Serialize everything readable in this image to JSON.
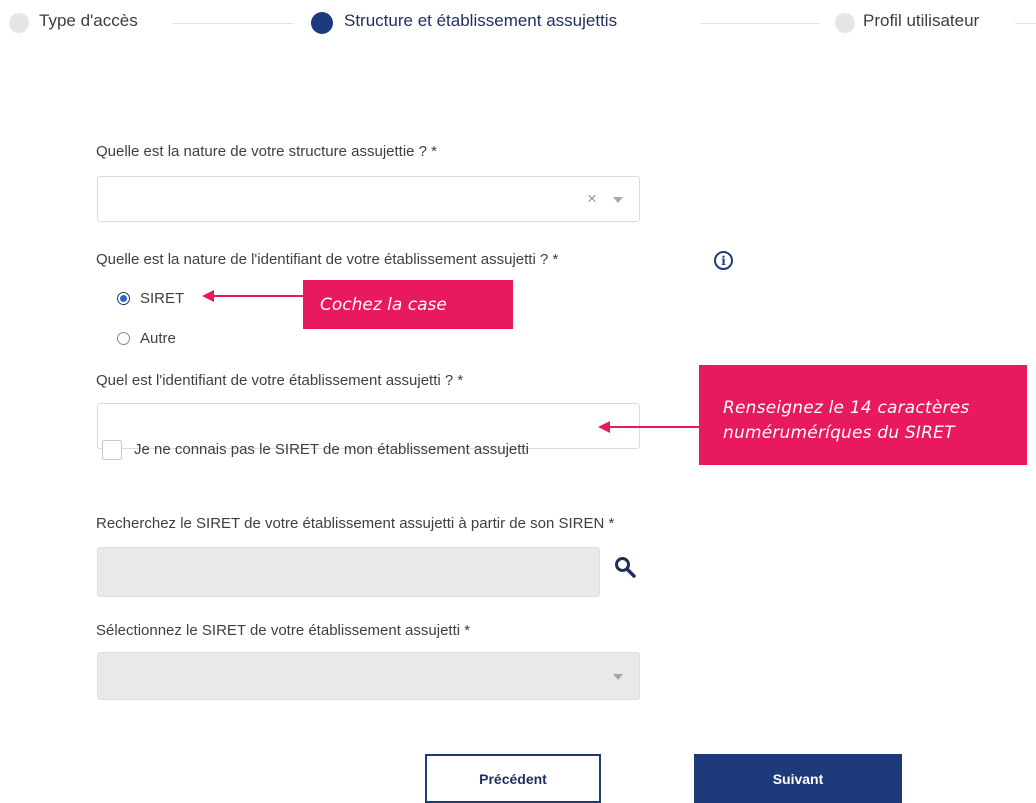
{
  "stepper": {
    "steps": [
      {
        "label": "Type d'accès",
        "state": "inactive"
      },
      {
        "label": "Structure et établissement assujettis",
        "state": "active"
      },
      {
        "label": "Profil utilisateur",
        "state": "inactive"
      }
    ]
  },
  "form": {
    "structure_nature_label": "Quelle est la nature de votre structure assujettie ? *",
    "structure_nature_value": "",
    "identifier_nature_label": "Quelle est la nature de l'identifiant de votre établissement assujetti ? *",
    "identifier_options": [
      {
        "label": "SIRET",
        "checked": true
      },
      {
        "label": "Autre",
        "checked": false
      }
    ],
    "identifier_label": "Quel est l'identifiant de votre établissement assujetti ? *",
    "identifier_value": "",
    "unknown_siret_label": "Je ne connais pas le SIRET de mon établissement assujetti",
    "search_siren_label": "Recherchez le SIRET de votre établissement assujetti à partir de son SIREN *",
    "search_siren_value": "",
    "select_siret_label": "Sélectionnez le SIRET de votre établissement assujetti *",
    "select_siret_value": ""
  },
  "callouts": {
    "check_box": "Cochez la case",
    "siret_line1": "Renseignez le 14 caractères",
    "siret_line2": "numéruméríques du SIRET"
  },
  "buttons": {
    "previous": "Précédent",
    "next": "Suivant"
  },
  "icons": {
    "clear": "close-icon",
    "dropdown": "chevron-down-icon",
    "info": "info-icon",
    "search": "search-icon"
  },
  "colors": {
    "primary": "#1d3a7c",
    "callout": "#e8195e",
    "disabled_field": "#e9e9e9"
  }
}
